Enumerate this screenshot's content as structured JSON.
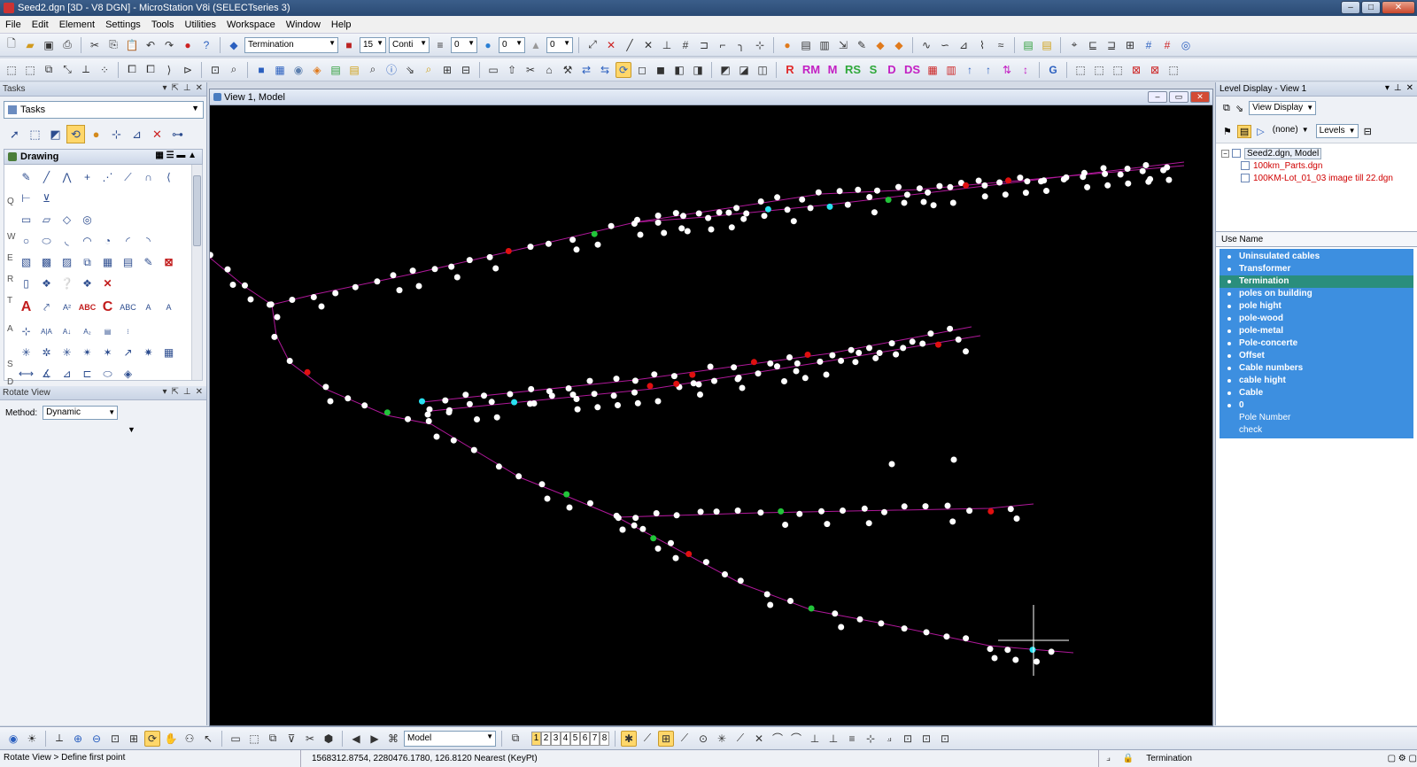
{
  "window": {
    "title": "Seed2.dgn [3D - V8 DGN] - MicroStation V8i (SELECTseries 3)",
    "controls": {
      "minimize": "–",
      "maximize": "□",
      "close": "✕"
    }
  },
  "menu": [
    "File",
    "Edit",
    "Element",
    "Settings",
    "Tools",
    "Utilities",
    "Workspace",
    "Window",
    "Help"
  ],
  "toolbar": {
    "active_level": "Termination",
    "color": "15",
    "line_style": "Conti",
    "line_weight": "0",
    "transparency": "0",
    "priority": "0",
    "colored_tools": [
      "R",
      "RM",
      "M",
      "RS",
      "S",
      "D",
      "DS"
    ]
  },
  "tasks_panel": {
    "title": "Tasks",
    "combo_value": "Tasks",
    "section": "Drawing",
    "side_letters": [
      "Q",
      "W",
      "E",
      "R",
      "T",
      "A",
      "S",
      "D"
    ],
    "text_tools": [
      "A",
      "ABC",
      "C",
      "ABC",
      "A",
      "A"
    ]
  },
  "rotate_view": {
    "title": "Rotate View",
    "method_label": "Method:",
    "method_value": "Dynamic"
  },
  "view": {
    "title": "View 1, Model"
  },
  "level_display": {
    "title": "Level Display - View 1",
    "view_display": "View Display",
    "filter": "(none)",
    "levels_button": "Levels",
    "tree_root": "Seed2.dgn, Model",
    "attachments": [
      "100km_Parts.dgn",
      "100KM-Lot_01_03 image till 22.dgn"
    ],
    "column_header": "Use Name",
    "levels": [
      {
        "name": "Uninsulated cables",
        "state": "on"
      },
      {
        "name": "Transformer",
        "state": "on"
      },
      {
        "name": "Termination",
        "state": "active"
      },
      {
        "name": "poles on building",
        "state": "on"
      },
      {
        "name": "pole hight",
        "state": "on"
      },
      {
        "name": "pole-wood",
        "state": "on"
      },
      {
        "name": "pole-metal",
        "state": "on"
      },
      {
        "name": "Pole-concerte",
        "state": "on"
      },
      {
        "name": "Offset",
        "state": "on"
      },
      {
        "name": "Cable numbers",
        "state": "on"
      },
      {
        "name": "cable hight",
        "state": "on"
      },
      {
        "name": "Cable",
        "state": "on"
      },
      {
        "name": "0",
        "state": "on"
      },
      {
        "name": "Pole Number",
        "state": "off"
      },
      {
        "name": "check",
        "state": "off"
      }
    ]
  },
  "bottom": {
    "model": "Model",
    "view_numbers": [
      "1",
      "2",
      "3",
      "4",
      "5",
      "6",
      "7",
      "8"
    ]
  },
  "status": {
    "prompt": "Rotate View > Define first point",
    "coords": "1568312.8754, 2280476.1780, 126.8120 Nearest (KeyPt)",
    "level": "Termination"
  },
  "colors": {
    "line": "#b0189a",
    "white_point": "#ffffff",
    "red_point": "#e01010",
    "green_point": "#22c43a",
    "cyan_point": "#29e0f0"
  }
}
